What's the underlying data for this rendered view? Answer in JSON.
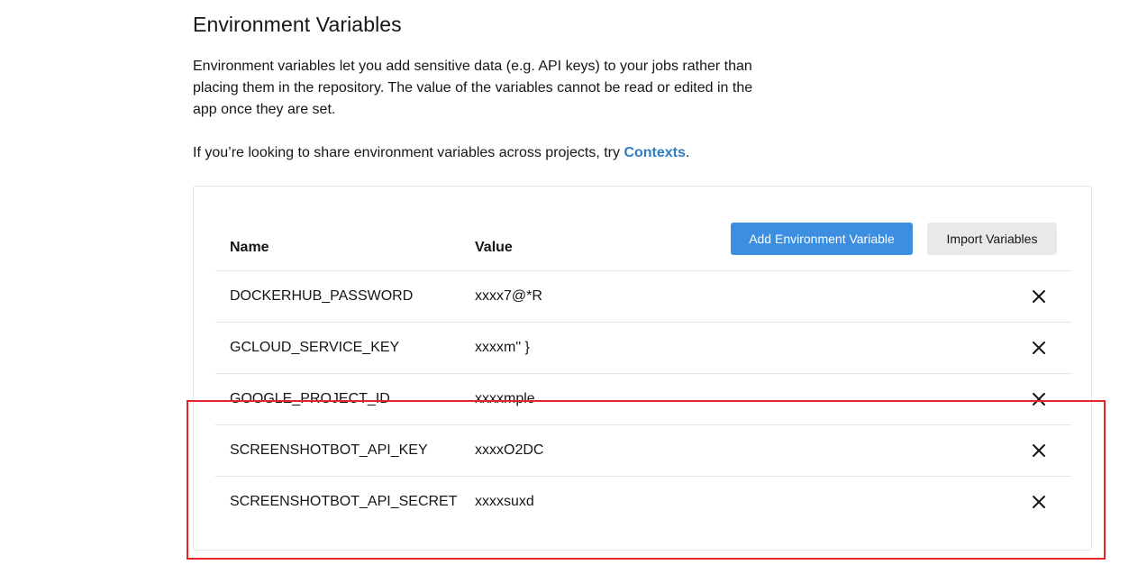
{
  "page": {
    "title": "Environment Variables",
    "description": "Environment variables let you add sensitive data (e.g. API keys) to your jobs rather than placing them in the repository. The value of the variables cannot be read or edited in the app once they are set.",
    "share_prefix": "If you’re looking to share environment variables across projects, try ",
    "share_link": "Contexts",
    "share_suffix": "."
  },
  "table": {
    "headers": {
      "name": "Name",
      "value": "Value"
    },
    "add_button": "Add Environment Variable",
    "import_button": "Import Variables",
    "rows": [
      {
        "name": "DOCKERHUB_PASSWORD",
        "value": "xxxx7@*R",
        "delete_icon": "close-icon"
      },
      {
        "name": "GCLOUD_SERVICE_KEY",
        "value": "xxxxm\" }",
        "delete_icon": "close-icon"
      },
      {
        "name": "GOOGLE_PROJECT_ID",
        "value": "xxxxmple",
        "delete_icon": "close-icon"
      },
      {
        "name": "SCREENSHOTBOT_API_KEY",
        "value": "xxxxO2DC",
        "delete_icon": "close-icon"
      },
      {
        "name": "SCREENSHOTBOT_API_SECRET",
        "value": "xxxxsuxd",
        "delete_icon": "close-icon"
      }
    ]
  },
  "colors": {
    "link": "#2f7cc1",
    "primary_button": "#3b8ee0",
    "secondary_button": "#e9e9e9",
    "highlight_box": "#e3262b"
  }
}
